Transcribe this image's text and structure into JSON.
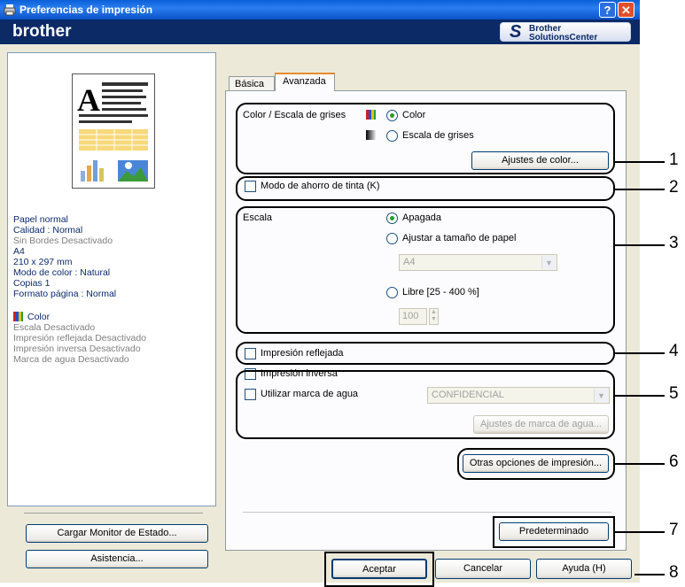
{
  "window": {
    "title": "Preferencias de impresión",
    "help_glyph": "?",
    "close_glyph": "✕"
  },
  "brand": {
    "logo_text": "brother",
    "solutions_line1": "Brother",
    "solutions_line2": "SolutionsCenter"
  },
  "summary": {
    "lines_navy": [
      "Papel normal",
      "Calidad  : Normal"
    ],
    "line_grey1": "Sin Bordes Desactivado",
    "lines_navy2": [
      "A4",
      "210 x 297 mm",
      "Modo de color : Natural",
      "Copias 1",
      "Formato página : Normal"
    ],
    "color_label": "Color",
    "lines_grey": [
      "Escala Desactivado",
      "Impresión reflejada Desactivado",
      "Impresión inversa Desactivado",
      "Marca de agua Desactivado"
    ]
  },
  "left_buttons": {
    "status_monitor": "Cargar Monitor de Estado...",
    "support": "Asistencia..."
  },
  "tabs": [
    {
      "label": "Básica",
      "active": false
    },
    {
      "label": "Avanzada",
      "active": true
    }
  ],
  "color_section": {
    "label": "Color / Escala de grises",
    "option_color": "Color",
    "option_gray": "Escala de grises",
    "selected": "Color",
    "settings_button": "Ajustes de color..."
  },
  "ink_save": {
    "label": "Modo de ahorro de tinta (K)",
    "checked": false
  },
  "scale": {
    "label": "Escala",
    "option_off": "Apagada",
    "option_fit": "Ajustar a tamaño de papel",
    "paper_value": "A4",
    "option_free": "Libre [25 - 400 %]",
    "free_value": "100",
    "selected": "Apagada"
  },
  "mirror": {
    "label": "Impresión reflejada",
    "checked": false
  },
  "reverse": {
    "label": "Impresión inversa",
    "checked": false
  },
  "watermark": {
    "label": "Utilizar marca de agua",
    "checked": false,
    "value": "CONFIDENCIAL",
    "settings_button": "Ajustes de marca de agua..."
  },
  "other_options_button": "Otras opciones de impresión...",
  "default_button": "Predeterminado",
  "footer": {
    "ok": "Aceptar",
    "cancel": "Cancelar",
    "help": "Ayuda (H)"
  },
  "callouts": [
    "1",
    "2",
    "3",
    "4",
    "5",
    "6",
    "7",
    "8"
  ],
  "colors": {
    "titlebar": "#0a5fd8",
    "brandbar": "#0c2a66",
    "close": "#e0502a",
    "dialog_bg": "#ece9d8",
    "radio_dot": "#21a121"
  },
  "icons": [
    "printer-icon",
    "help-icon",
    "close-icon",
    "brother-s-icon",
    "color-swatch-icon",
    "grayscale-swatch-icon",
    "dropdown-arrow-icon",
    "spin-arrows-icon"
  ]
}
